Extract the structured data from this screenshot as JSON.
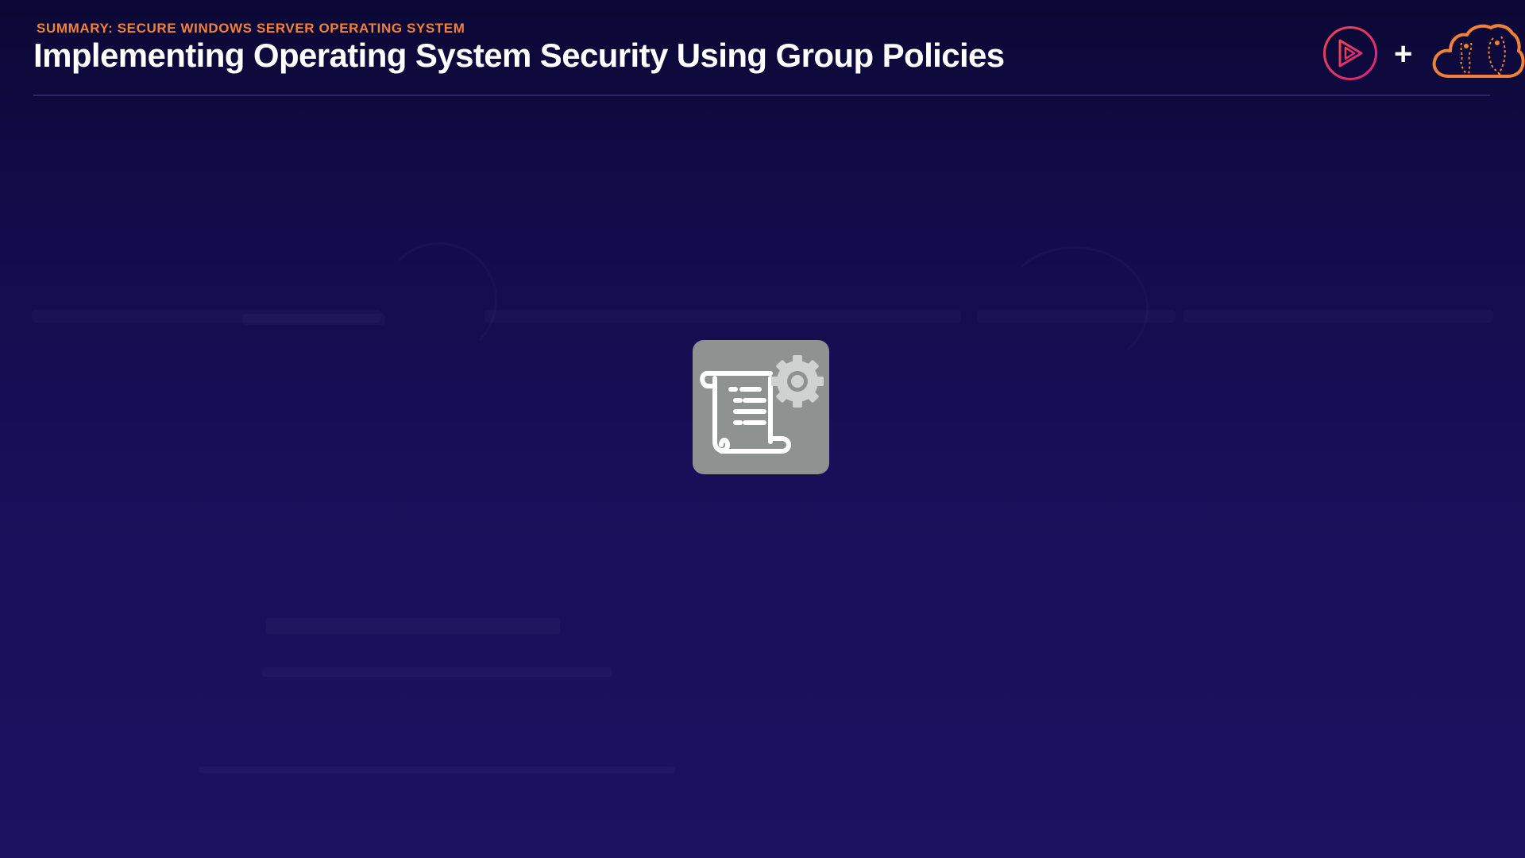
{
  "header": {
    "section_label": "SUMMARY: SECURE WINDOWS SERVER OPERATING SYSTEM",
    "title": "Implementing Operating System Security Using Group Policies",
    "plus_sign": "+"
  },
  "logos": {
    "play_logo": "play-triangle-circle-logo",
    "cloud_logo": "cloud-logo"
  },
  "center_icon": {
    "icon": "policy-scroll-gear-icon"
  },
  "colors": {
    "background_top": "#0b0835",
    "background_bottom": "#1b1360",
    "accent_orange": "#f1813a",
    "play_logo_pink": "#e8336d",
    "tile_gray": "#8e9392"
  }
}
